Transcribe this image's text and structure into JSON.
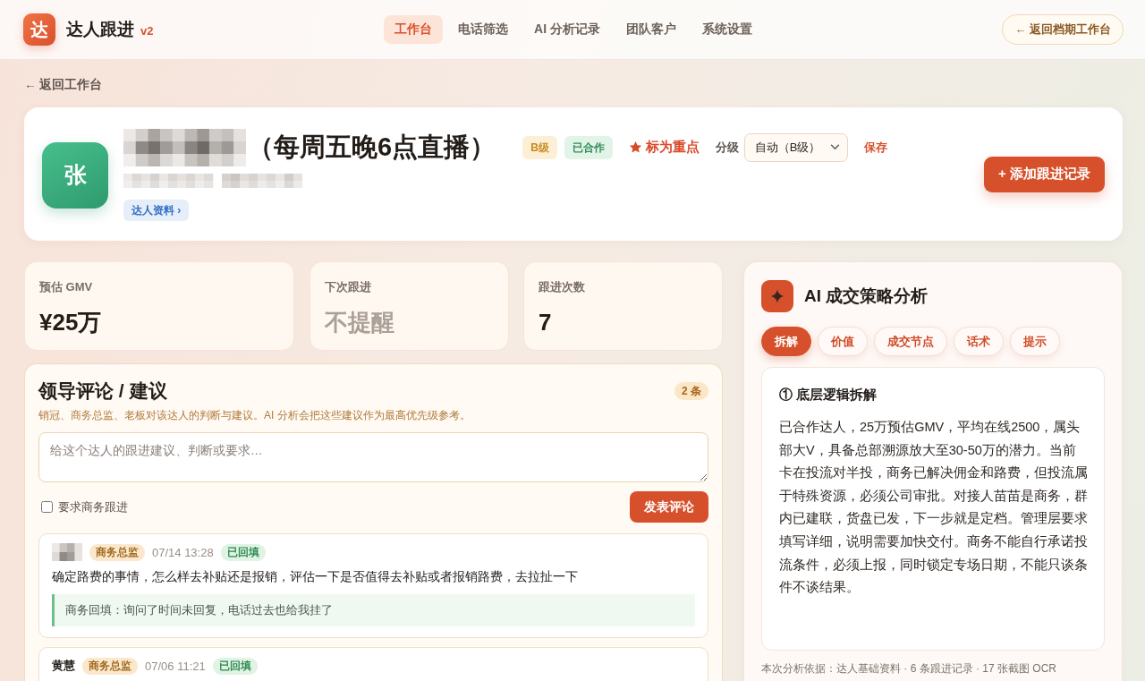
{
  "header": {
    "logo": "达",
    "app_name": "达人跟进",
    "version": "v2",
    "nav": [
      {
        "label": "工作台",
        "selected": true
      },
      {
        "label": "电话筛选",
        "selected": false
      },
      {
        "label": "AI 分析记录",
        "selected": false
      },
      {
        "label": "团队客户",
        "selected": false
      },
      {
        "label": "系统设置",
        "selected": false
      }
    ],
    "back_button": "← 返回档期工作台"
  },
  "back_link": "← 返回工作台",
  "profile": {
    "avatar": "张",
    "name_note": "（每周五晚6点直播）",
    "badges": [
      {
        "label": "B级",
        "kind": "grade"
      },
      {
        "label": "已合作",
        "kind": "relation"
      }
    ],
    "focus_action": "标为重点",
    "grade_label": "分级",
    "grade_value": "自动（B级）",
    "save": "保存",
    "profile_link": "达人资料 ›",
    "add_button": "+ 添加跟进记录"
  },
  "stats": [
    {
      "label": "预估 GMV",
      "value": "¥25万",
      "muted": false
    },
    {
      "label": "下次跟进",
      "value": "不提醒",
      "muted": true
    },
    {
      "label": "跟进次数",
      "value": "7",
      "muted": false
    }
  ],
  "comments": {
    "title": "领导评论 / 建议",
    "count": "2 条",
    "description": "销冠、商务总监、老板对该达人的判断与建议。AI 分析会把这些建议作为最高优先级参考。",
    "input": {
      "placeholder": "给这个达人的跟进建议、判断或要求…"
    },
    "require_followup": {
      "label": "要求商务跟进",
      "checked": false
    },
    "submit": "发表评论",
    "items": [
      {
        "role": "商务总监",
        "time": "07/14 13:28",
        "status": "已回填",
        "text": "确定路费的事情，怎么样去补贴还是报销，评估一下是否值得去补贴或者报销路费，去拉扯一下",
        "reply": "商务回填：询问了时间未回复，电话过去也给我挂了"
      },
      {
        "author": "黄慧",
        "role": "商务总监",
        "time": "07/06 11:21",
        "status": "已回填"
      }
    ]
  },
  "ai_panel": {
    "title": "AI 成交策略分析",
    "tabs": [
      {
        "label": "拆解",
        "selected": true
      },
      {
        "label": "价值",
        "selected": false
      },
      {
        "label": "成交节点",
        "selected": false
      },
      {
        "label": "话术",
        "selected": false
      },
      {
        "label": "提示",
        "selected": false
      }
    ],
    "section_title": "① 底层逻辑拆解",
    "body": "已合作达人，25万预估GMV，平均在线2500，属头部大V，具备总部溯源放大至30-50万的潜力。当前卡在投流对半投，商务已解决佣金和路费，但投流属于特殊资源，必须公司审批。对接人苗苗是商务，群内已建联，货盘已发，下一步就是定档。管理层要求填写详细，说明需要加快交付。商务不能自行承诺投流条件，必须上报，同时锁定专场日期，不能只谈条件不谈结果。",
    "footer": "本次分析依据：达人基础资料 · 6 条跟进记录 · 17 张截图 OCR"
  }
}
